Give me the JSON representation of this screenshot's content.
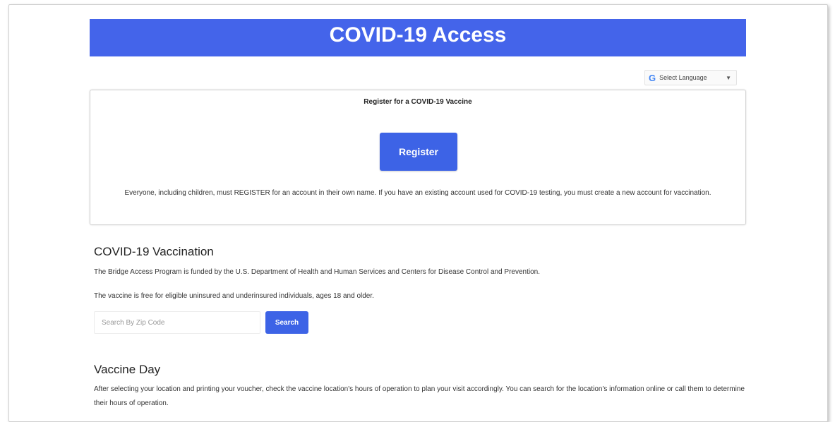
{
  "header": {
    "title": "COVID-19 Access",
    "background_color": "#4464ea"
  },
  "language_select": {
    "icon": "google-g-icon",
    "label": "Select Language",
    "caret": "▼"
  },
  "register_card": {
    "heading": "Register for a COVID-19 Vaccine",
    "button_label": "Register",
    "note": "Everyone, including children, must REGISTER for an account in their own name. If you have an existing account used for COVID-19 testing, you must create a new account for vaccination."
  },
  "vaccination": {
    "heading": "COVID-19 Vaccination",
    "paragraph1": "The Bridge Access Program is funded by the U.S. Department of Health and Human Services and Centers for Disease Control and Prevention.",
    "paragraph2": "The vaccine is free for eligible uninsured and underinsured individuals, ages 18 and older.",
    "search": {
      "placeholder": "Search By Zip Code",
      "value": "",
      "button_label": "Search"
    }
  },
  "vaccine_day": {
    "heading": "Vaccine Day",
    "text": "After selecting your location and printing your voucher, check the vaccine location's hours of operation to plan your visit accordingly. You can search for the location's information online or call them to determine their hours of operation."
  },
  "colors": {
    "accent": "#3d63e6"
  }
}
